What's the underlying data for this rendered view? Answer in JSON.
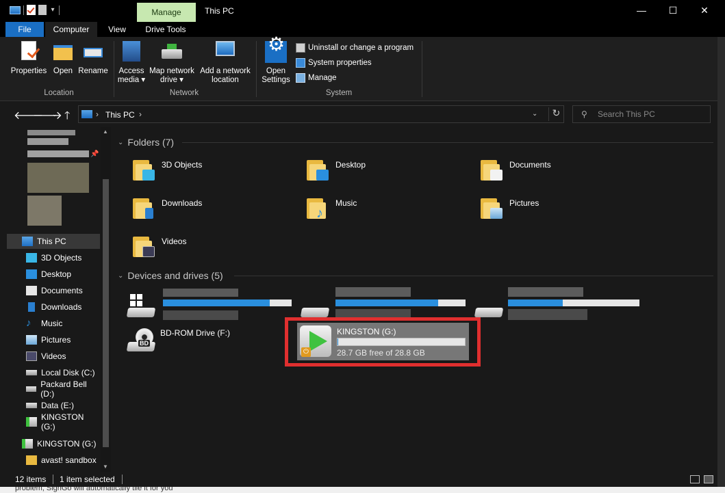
{
  "window": {
    "title": "This PC",
    "context_tab": "Manage",
    "controls": {
      "minimize": "—",
      "maximize": "☐",
      "close": "✕"
    }
  },
  "ribbon": {
    "tabs": [
      "File",
      "Computer",
      "View",
      "Drive Tools"
    ],
    "active_tab": "Computer",
    "groups": {
      "location": {
        "label": "Location",
        "buttons": [
          {
            "label": "Properties",
            "icon": "properties-icon"
          },
          {
            "label": "Open",
            "icon": "open-icon"
          },
          {
            "label": "Rename",
            "icon": "rename-icon"
          }
        ]
      },
      "network": {
        "label": "Network",
        "buttons": [
          {
            "label_line1": "Access",
            "label_line2": "media ▾",
            "icon": "access-media-icon"
          },
          {
            "label_line1": "Map network",
            "label_line2": "drive ▾",
            "icon": "map-network-drive-icon"
          },
          {
            "label_line1": "Add a network",
            "label_line2": "location",
            "icon": "add-network-location-icon"
          }
        ]
      },
      "system": {
        "label": "System",
        "open_settings_line1": "Open",
        "open_settings_line2": "Settings",
        "small_buttons": [
          "Uninstall or change a program",
          "System properties",
          "Manage"
        ]
      }
    },
    "help": "?"
  },
  "address": {
    "path": "This PC",
    "separator": "›",
    "search_placeholder": "Search This PC"
  },
  "nav_pane": {
    "items": [
      {
        "label": "This PC",
        "icon": "this-pc-icon",
        "selected": true
      },
      {
        "label": "3D Objects",
        "icon": "3d-objects-icon"
      },
      {
        "label": "Desktop",
        "icon": "desktop-icon"
      },
      {
        "label": "Documents",
        "icon": "documents-icon"
      },
      {
        "label": "Downloads",
        "icon": "downloads-icon"
      },
      {
        "label": "Music",
        "icon": "music-icon"
      },
      {
        "label": "Pictures",
        "icon": "pictures-icon"
      },
      {
        "label": "Videos",
        "icon": "videos-icon"
      },
      {
        "label": "Local Disk (C:)",
        "icon": "local-disk-icon"
      },
      {
        "label": "Packard Bell (D:)",
        "icon": "drive-icon"
      },
      {
        "label": "Data (E:)",
        "icon": "drive-icon"
      },
      {
        "label": "KINGSTON (G:)",
        "icon": "usb-drive-icon"
      },
      {
        "label": "KINGSTON (G:)",
        "icon": "usb-drive-icon"
      },
      {
        "label": "avast! sandbox",
        "icon": "folder-icon"
      }
    ]
  },
  "content": {
    "folders_header": "Folders (7)",
    "folders": [
      "3D Objects",
      "Desktop",
      "Documents",
      "Downloads",
      "Music",
      "Pictures",
      "Videos"
    ],
    "devices_header": "Devices and drives (5)",
    "bdrom": {
      "name": "BD-ROM Drive (F:)",
      "badge": "BD"
    },
    "kingston": {
      "name": "KINGSTON (G:)",
      "free_text": "28.7 GB free of 28.8 GB",
      "used_fraction": 0.0035
    }
  },
  "status": {
    "items_count": "12 items",
    "selection": "1 item selected"
  },
  "bottom_text": "problem, SignGo will automatically tile it for you"
}
